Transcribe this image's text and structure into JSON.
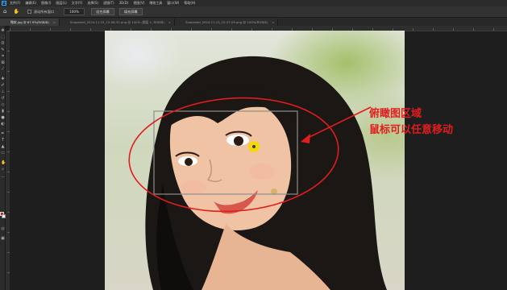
{
  "app": {
    "logo_text": "Ps",
    "menu": [
      "文件(F)",
      "编辑(E)",
      "图像(I)",
      "图层(L)",
      "文字(Y)",
      "选择(S)",
      "滤镜(T)",
      "3D(D)",
      "视图(V)",
      "增效工具",
      "窗口(W)",
      "帮助(H)"
    ]
  },
  "options": {
    "home_icon": "home-icon",
    "tool_icon": "zoom-tool-icon",
    "scroll_all_label": "滚动所有窗口",
    "zoom_value": "100%",
    "fit_screen_label": "适合屏幕",
    "fill_screen_label": "填充屏幕"
  },
  "tabs": [
    {
      "label": "微软.jpg @ 67.9%(RGB/8)",
      "active": true
    },
    {
      "label": "Snapseed_2024-11-15_15-08-32.png @ 100% (图层 1, RGB/8)",
      "active": false
    },
    {
      "label": "Snapseed_2024-11-15_15-47-09.png @ 100%(RGB/8)",
      "active": false
    }
  ],
  "annotation": {
    "line1": "俯瞰图区域",
    "line2": "鼠标可以任意移动",
    "color": "#e11d1d"
  },
  "colors": {
    "foreground": "#d21f1f",
    "background": "#ffffff",
    "cursor": "#f5d800"
  }
}
